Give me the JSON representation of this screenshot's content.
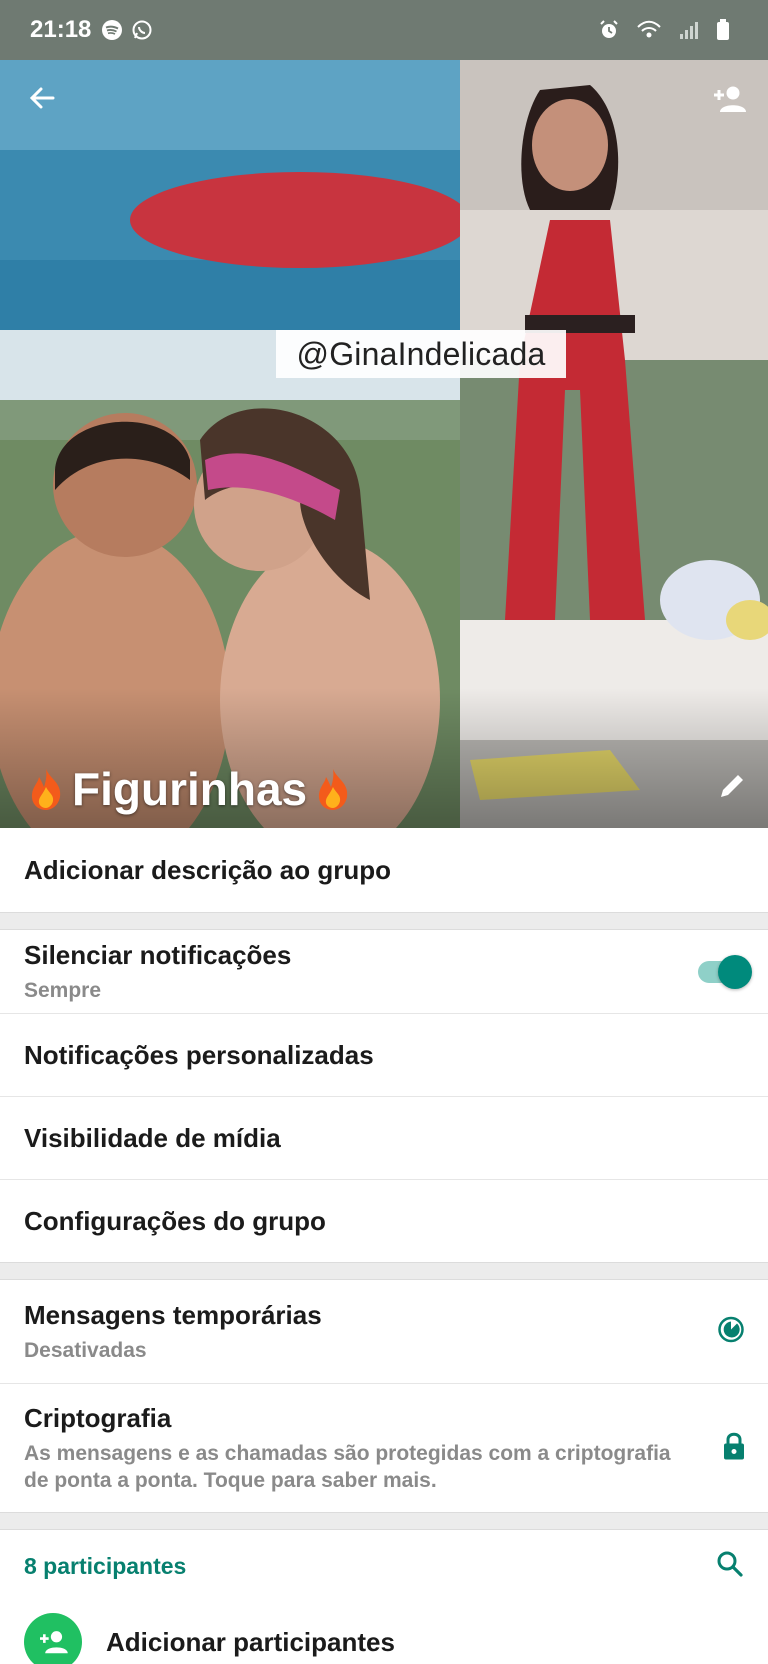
{
  "status_bar": {
    "time": "21:18",
    "left_icons": [
      "spotify-icon",
      "whatsapp-icon"
    ],
    "right_icons": [
      "alarm-icon",
      "wifi-icon",
      "signal-icon",
      "battery-icon"
    ]
  },
  "header": {
    "watermark": "@GinaIndelicada",
    "group_name": "Figurinhas",
    "group_name_emoji": "fire-icon",
    "icons": [
      "back-arrow-icon",
      "add-person-icon",
      "pencil-icon"
    ]
  },
  "description": {
    "label": "Adicionar descrição ao grupo"
  },
  "notifications": {
    "mute_title": "Silenciar notificações",
    "mute_value": "Sempre",
    "mute_on": true,
    "custom": "Notificações personalizadas",
    "media_visibility": "Visibilidade de mídia",
    "group_settings": "Configurações do grupo"
  },
  "privacy": {
    "temp_title": "Mensagens temporárias",
    "temp_value": "Desativadas",
    "crypto_title": "Criptografia",
    "crypto_desc": "As mensagens e as chamadas são protegidas com a criptografia de ponta a ponta. Toque para saber mais."
  },
  "participants": {
    "count_label": "8 participantes",
    "add_label": "Adicionar participantes"
  },
  "colors": {
    "accent": "#07806f",
    "toggle_on": "#008a7c",
    "add_green": "#20c062",
    "status_bar": "#6f7a72"
  }
}
